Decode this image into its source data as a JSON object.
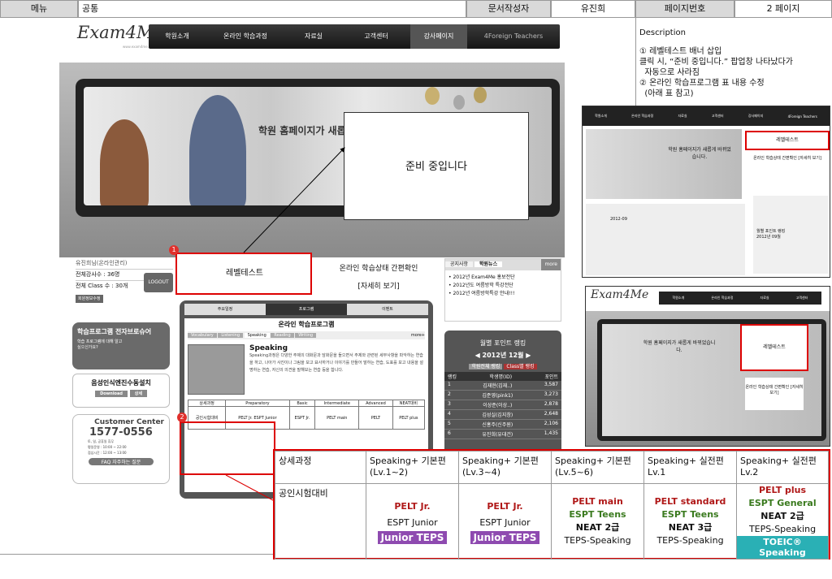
{
  "header": {
    "menu_label": "메뉴",
    "menu_value": "공통",
    "author_label": "문서작성자",
    "author_value": "유진희",
    "page_label": "페이지번호",
    "page_value": "2 페이지"
  },
  "site": {
    "logo": "Exam4Me",
    "logo_sub": "www.exam4me.com",
    "nav": [
      "학원소개",
      "온라인 학습과정",
      "자료실",
      "고객센터",
      "강사페이지",
      "4Foreign Teachers"
    ],
    "banner_title": "학원 홈페이지가 새롭",
    "popup_text": "준비 중입니다",
    "login": {
      "user": "유진희님(온라인관리)",
      "teachers": "전체강사수 : 36명",
      "classes": "전체 Class 수 : 30개",
      "logout": "LOGOUT",
      "member_info": "회원정보수정"
    },
    "level_test": "레벨테스트",
    "online_status": "온라인 학습상태 간편확인",
    "online_status_more": "[자세히 보기]",
    "notice_tabs": [
      "공지사항",
      "학원뉴스"
    ],
    "notice_more": "more",
    "news": [
      "2012년 Exam4Me 홍보전단",
      "2012년도 여름방학 특강전단",
      "2012년 여름방학특강 안내!!!"
    ],
    "ebrochure": "학습프로그램 전자브로슈어",
    "ebrochure_sub": "학습 프로그램에 대해 알고 싶으신가요?",
    "voice_engine": "음성인식엔진수동설치",
    "download": "Download",
    "detail": "상세",
    "customer_center": "Customer Center",
    "phone": "1577-0556",
    "hours1": "토, 일, 공휴일 휴무",
    "hours2": "평일운영 : 10:00 ~ 22:00",
    "hours3": "점심시간 : 12:00 ~ 13:00",
    "faq": "FAQ 자주하는 질문",
    "schedule_tabs": [
      "주요일정",
      "프로그램",
      "이벤트"
    ],
    "program_title": "온라인 학습프로그램",
    "program_tabs": [
      "Vocabulary",
      "Listening",
      "Speaking",
      "Reading",
      "Writing"
    ],
    "program_more": "more+",
    "speaking_title": "Speaking",
    "speaking_desc": "Speaking과정은 다양한 주제의 대화문과 담화문을 들으면서 주제와 관련된 세부사항을 파악하는 연습을 하고, 나아가 사진이나 그림을 보고 묘사하거나 이야기를 만들어 말하는 연습, 도표를 보고 내용을 설명하는 연습, 자신의 의견을 말해보는 연습 등을 합니다.",
    "small_table_head": [
      "상세과정",
      "Preparatory",
      "Basic",
      "Intermediate",
      "Advanced",
      "NEAT대비"
    ],
    "small_table_row": [
      "공인시험대비",
      "PELT Jr. ESPT Junior",
      "ESPT Jr.",
      "PELT main",
      "PELT",
      "PELT plus"
    ],
    "ranking_title": "월별 포인트 랭킹",
    "ranking_month": "2012년 12월",
    "ranking_tabs": [
      "학원전체 랭킹",
      "Class별 랭킹"
    ],
    "ranking_head": [
      "랭킹",
      "학생명(ID)",
      "포인트"
    ],
    "ranking": [
      {
        "rank": "1",
        "name": "김재현(김재..)",
        "points": "3,587"
      },
      {
        "rank": "2",
        "name": "김준영(pink1)",
        "points": "3,273"
      },
      {
        "rank": "3",
        "name": "이상준(이상..)",
        "points": "2,878"
      },
      {
        "rank": "4",
        "name": "김성실(김지창)",
        "points": "2,648"
      },
      {
        "rank": "5",
        "name": "신홍주(신주원)",
        "points": "2,106"
      },
      {
        "rank": "6",
        "name": "유진희(유대건)",
        "points": "1,435"
      }
    ]
  },
  "description": {
    "title": "Description",
    "lines": [
      "① 레벨테스트 배너 삽입",
      "클릭 시, “준비 중입니다.” 팝업창 나타났다가",
      "  자동으로 사라짐",
      "② 온라인 학습프로그램 표 내용 수정",
      "  (아래 표 참고)"
    ]
  },
  "thumb1": {
    "nav": [
      "학원소개",
      "온라인 학습과정",
      "자료실",
      "고객센터",
      "강사페이지",
      "4Foreign Teachers"
    ],
    "banner_title": "학원 홈페이지가 새롭게 바뀌었습니다.",
    "level_test": "레벨테스트",
    "online_status": "온라인 학습상태 간편확인 [자세히 보기]",
    "calendar_month": "2012-09",
    "ranking_title": "월별 포인트 랭킹",
    "ranking_month": "2012년 09월"
  },
  "thumb2": {
    "logo": "Exam4Me",
    "nav": [
      "학원소개",
      "온라인 학습과정",
      "자료실",
      "고객센터"
    ],
    "banner_title": "학원 홈페이지가 새롭게 바뀌었습니다.",
    "level_test": "레벨테스트",
    "online_status": "온라인 학습상태 간편확인 [자세히 보기]"
  },
  "bigtable": {
    "headers": [
      "상세과정",
      "Speaking+ 기본편 (Lv.1~2)",
      "Speaking+ 기본편 (Lv.3~4)",
      "Speaking+ 기본편 (Lv.5~6)",
      "Speaking+ 실전편 Lv.1",
      "Speaking+ 실전편 Lv.2"
    ],
    "row_label": "공인시험대비",
    "col1": [
      "PELT Jr.",
      "ESPT Junior",
      "Junior TEPS"
    ],
    "col2": [
      "PELT Jr.",
      "ESPT Junior",
      "Junior TEPS"
    ],
    "col3": [
      "PELT main",
      "ESPT Teens",
      "NEAT 2급",
      "TEPS-Speaking"
    ],
    "col4": [
      "PELT standard",
      "ESPT Teens",
      "NEAT 3급",
      "TEPS-Speaking"
    ],
    "col5": [
      "PELT plus",
      "ESPT General",
      "NEAT 2급",
      "TEPS-Speaking",
      "TOEIC® Speaking"
    ]
  },
  "markers": [
    "1",
    "2"
  ]
}
